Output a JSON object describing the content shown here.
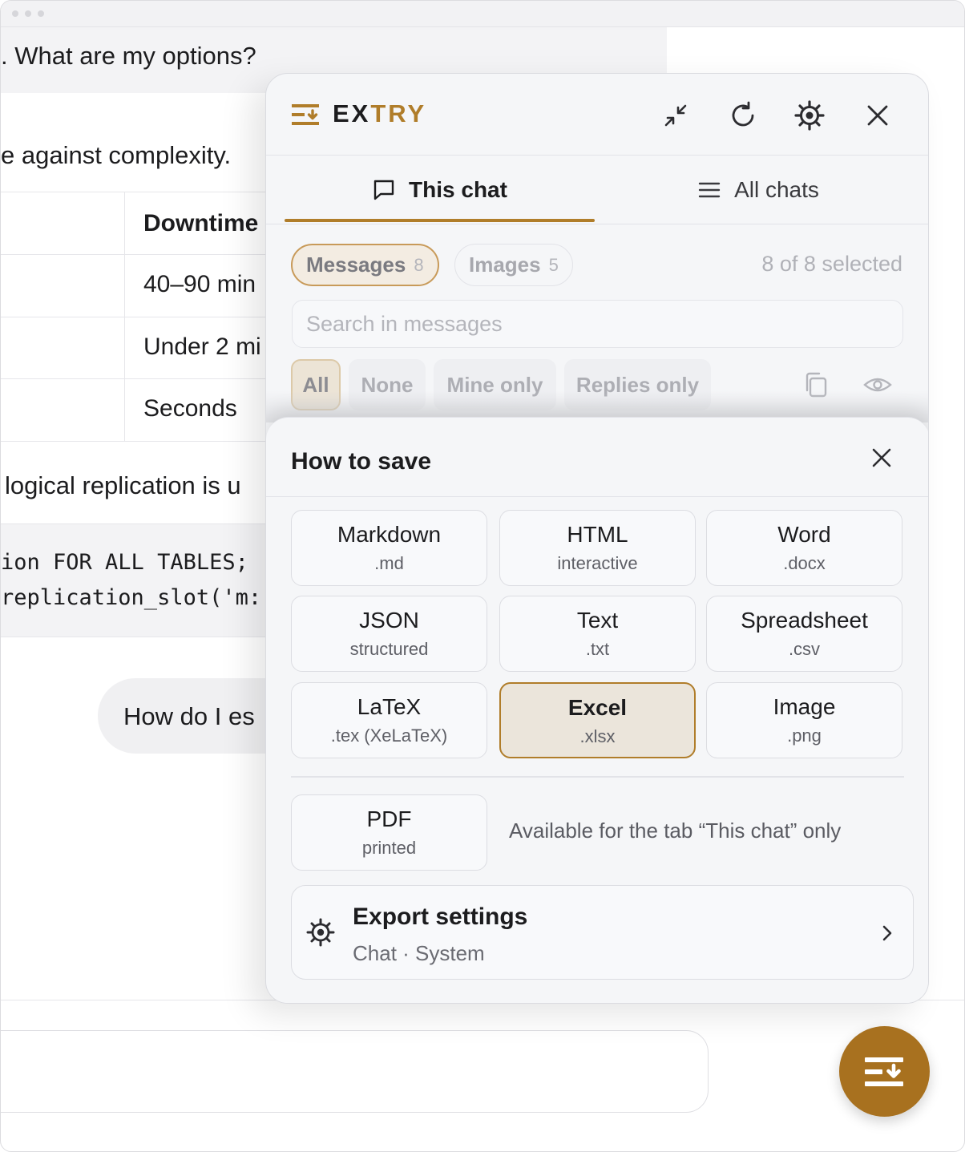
{
  "background_chat": {
    "question_tail": ". What are my options?",
    "answer_line": "e against complexity.",
    "table_header": "Downtime",
    "table_cells": [
      "40–90 min",
      "Under 2 mi",
      "Seconds"
    ],
    "logical_line": "logical replication is u",
    "code_lines": [
      "ion FOR ALL TABLES;",
      "replication_slot('m:"
    ],
    "bubble_text": "How do I es"
  },
  "extension": {
    "brand_prefix": "EX",
    "brand_accent": "TRY",
    "accent_color": "#b07d2a",
    "header_icons": [
      "collapse-icon",
      "refresh-icon",
      "gear-icon",
      "close-icon"
    ],
    "tabs": [
      {
        "label": "This chat",
        "icon": "chat-bubble-icon",
        "active": true
      },
      {
        "label": "All chats",
        "icon": "list-icon",
        "active": false
      }
    ],
    "pills": [
      {
        "label": "Messages",
        "count": "8",
        "selected": true
      },
      {
        "label": "Images",
        "count": "5",
        "selected": false
      }
    ],
    "selection_status": "8 of 8 selected",
    "search_placeholder": "Search in messages",
    "filters": [
      {
        "label": "All",
        "selected": true
      },
      {
        "label": "None",
        "selected": false
      },
      {
        "label": "Mine only",
        "selected": false
      },
      {
        "label": "Replies only",
        "selected": false
      }
    ],
    "filter_icons": [
      "copy-icon",
      "eye-icon"
    ]
  },
  "save_sheet": {
    "title": "How to save",
    "formats": [
      {
        "name": "Markdown",
        "sub": ".md",
        "selected": false
      },
      {
        "name": "HTML",
        "sub": "interactive",
        "selected": false
      },
      {
        "name": "Word",
        "sub": ".docx",
        "selected": false
      },
      {
        "name": "JSON",
        "sub": "structured",
        "selected": false
      },
      {
        "name": "Text",
        "sub": ".txt",
        "selected": false
      },
      {
        "name": "Spreadsheet",
        "sub": ".csv",
        "selected": false
      },
      {
        "name": "LaTeX",
        "sub": ".tex (XeLaTeX)",
        "selected": false
      },
      {
        "name": "Excel",
        "sub": ".xlsx",
        "selected": true
      },
      {
        "name": "Image",
        "sub": ".png",
        "selected": false
      }
    ],
    "pdf": {
      "name": "PDF",
      "sub": "printed"
    },
    "pdf_note": "Available for the tab “This chat” only",
    "export_settings": {
      "title": "Export settings",
      "sub": "Chat · System"
    }
  },
  "fab": {
    "icon": "extry-logo-icon",
    "color": "#a8711f"
  }
}
